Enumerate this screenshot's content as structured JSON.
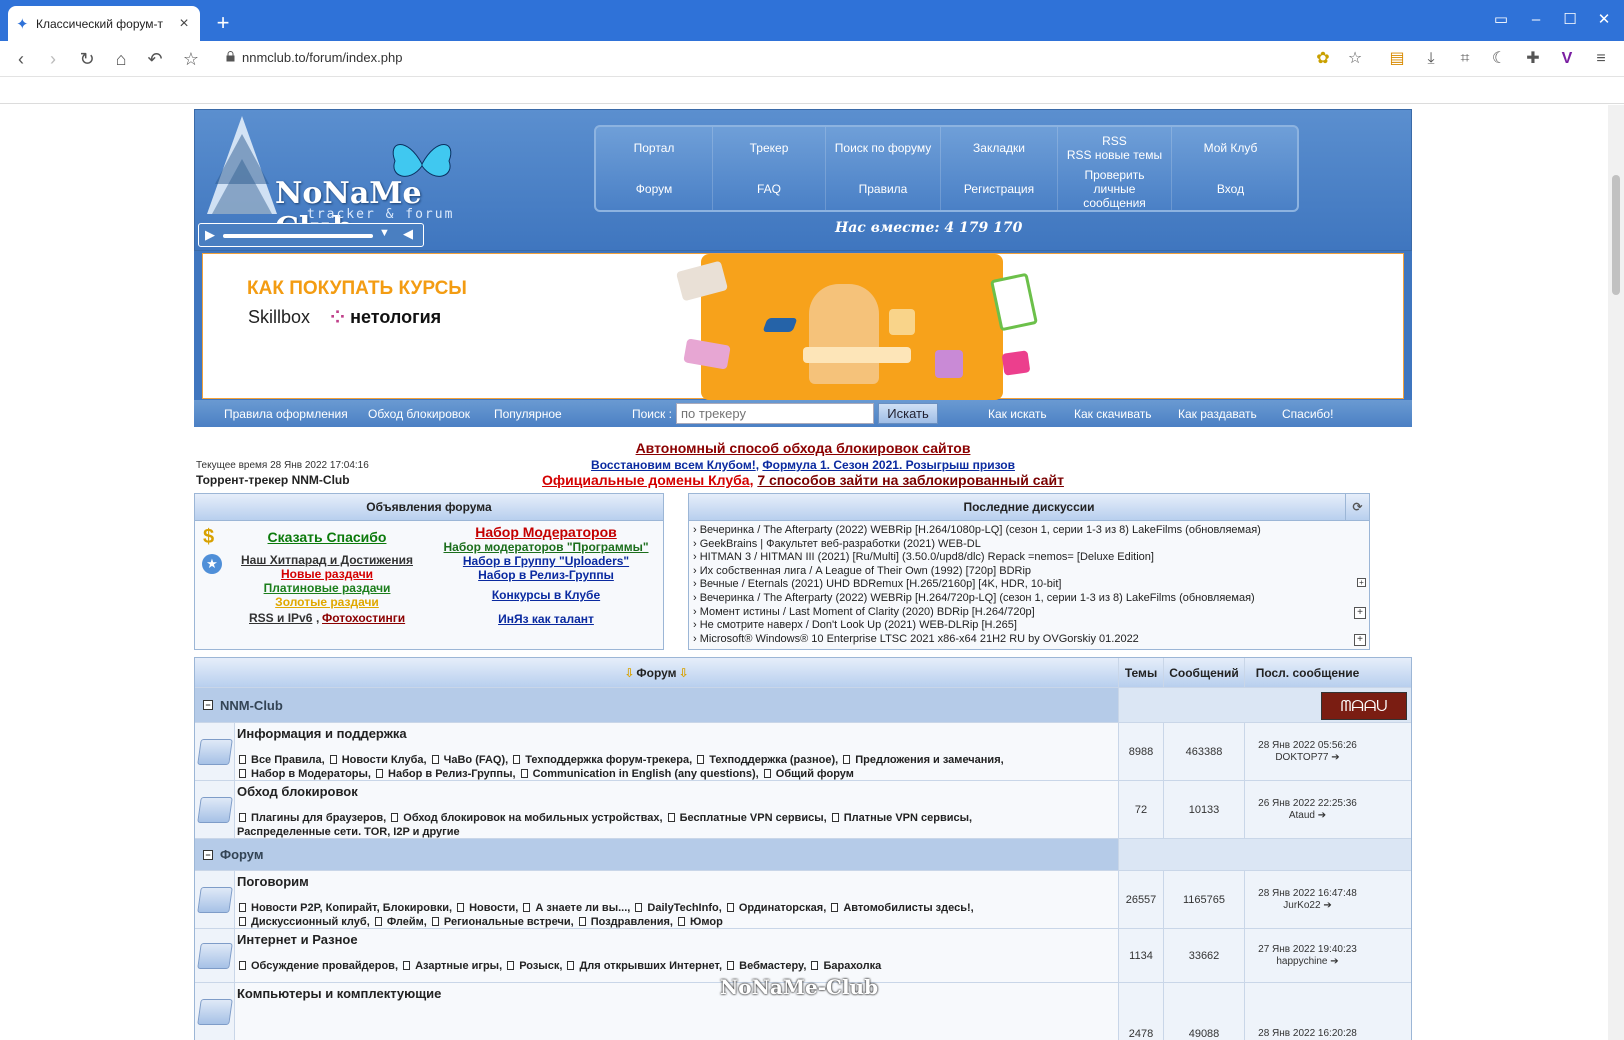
{
  "browser": {
    "tab_title": "Классический форум-т",
    "url": "nnmclub.to/forum/index.php"
  },
  "header": {
    "logo_text": "NoNaMe Club",
    "logo_sub": "tracker & forum",
    "together": "Нас вместе: 4 179 170",
    "nav": [
      "Портал",
      "Трекер",
      "Поиск по форуму",
      "Закладки",
      "RSS\nRSS новые темы",
      "Мой Клуб",
      "Форум",
      "FAQ",
      "Правила",
      "Регистрация",
      "Проверить личные сообщения",
      "Вход"
    ]
  },
  "banner": {
    "title": "КАК ПОКУПАТЬ КУРСЫ",
    "brand1": "Skillbox",
    "brand2": "нетология"
  },
  "navbar": {
    "links_left": [
      "Правила оформления",
      "Обход блокировок",
      "Популярное"
    ],
    "search_label": "Поиск :",
    "search_placeholder": "по трекеру",
    "search_button": "Искать",
    "links_right": [
      "Как искать",
      "Как скачивать",
      "Как раздавать",
      "Спасибо!"
    ]
  },
  "info": {
    "time": "Текущее время 28 Янв 2022 17:04:16",
    "tracker_name": "Торрент-трекер NNM-Club",
    "ann1": "Автономный способ обхода блокировок сайтов",
    "ann2a": "Восстановим всем Клубом!",
    "ann2b": "Формула 1. Сезон 2021. Розыгрыш призов",
    "ann3a": "Официальные домены Клуба",
    "ann3b": "7 способов зайти на заблокированный сайт"
  },
  "ann_panel": {
    "title": "Объявления форума",
    "thanks": "Сказать Спасибо",
    "hits": "Наш Хитпарад и Достижения",
    "new": "Новые раздачи",
    "platinum": "Платиновые раздачи",
    "gold": "Золотые раздачи",
    "rss": "RSS и IPv6",
    "photo": "Фотохостинги",
    "mods": "Набор Модераторов",
    "mods_prog": "Набор модераторов \"Программы\"",
    "uploaders": "Набор в Группу \"Uploaders\"",
    "release": "Набор в Релиз-Группы",
    "contests": "Конкурсы в Клубе",
    "inyaz": "ИнЯз как талант"
  },
  "disc_panel": {
    "title": "Последние дискуссии",
    "items": [
      "› Вечеринка / The Afterparty (2022) WEBRip [H.264/1080p-LQ] (сезон 1, серии 1-3 из 8) LakeFilms (обновляемая)",
      "› GeekBrains | Факультет веб-разработки (2021) WEB-DL",
      "› HITMAN 3 / HITMAN III (2021) [Ru/Multi] (3.50.0/upd8/dlc) Repack =nemos= [Deluxe Edition]",
      "› Их собственная лига / A League of Their Own (1992) [720p] BDRip",
      "› Вечные / Eternals (2021) UHD BDRemux [H.265/2160p] [4K, HDR, 10-bit]",
      "› Вечеринка / The Afterparty (2022) WEBRip [H.264/720p-LQ] (сезон 1, серии 1-3 из 8) LakeFilms (обновляемая)",
      "› Момент истины / Last Moment of Clarity (2020) BDRip [H.264/720p]",
      "› Не смотрите наверх / Don't Look Up (2021) WEB-DLRip [H.265]",
      "› Microsoft® Windows® 10 Enterprise LTSC 2021 x86-x64 21H2 RU by OVGorskiy 01.2022"
    ]
  },
  "forum": {
    "header": {
      "forum": "Форум",
      "topics": "Темы",
      "posts": "Сообщений",
      "last": "Посл. сообщение"
    },
    "categories": [
      {
        "name": "NNM-Club",
        "forums": [
          {
            "title": "Информация и поддержка",
            "subs": [
              "Все Правила",
              "Новости Клуба",
              "ЧаВо (FAQ)",
              "Техподдержка форум-трекера",
              "Техподдержка (разное)",
              "Предложения и замечания",
              "Набор в Модераторы",
              "Набор в Релиз-Группы",
              "Communication in English (any questions)",
              "Общий форум"
            ],
            "topics": "8988",
            "posts": "463388",
            "last_date": "28 Янв 2022 05:56:26",
            "last_user": "DOKTOP77"
          },
          {
            "title": "Обход блокировок",
            "subs": [
              "Плагины для браузеров",
              "Обход блокировок на мобильных устройствах",
              "Бесплатные VPN сервисы",
              "Платные VPN сервисы",
              "Распределенные сети. TOR, I2P и другие"
            ],
            "topics": "72",
            "posts": "10133",
            "last_date": "26 Янв 2022 22:25:36",
            "last_user": "Ataud"
          }
        ]
      },
      {
        "name": "Форум",
        "forums": [
          {
            "title": "Поговорим",
            "subs": [
              "Новости P2P, Копирайт, Блокировки",
              "Новости",
              "А знаете ли вы...",
              "DailyTechInfo",
              "Ординаторская",
              "Автомобилисты здесь!",
              "Дискуссионный клуб",
              "Флейм",
              "Региональные встречи",
              "Поздравления",
              "Юмор"
            ],
            "topics": "26557",
            "posts": "1165765",
            "last_date": "28 Янв 2022 16:47:48",
            "last_user": "JurKo22"
          },
          {
            "title": "Интернет и Разное",
            "subs": [
              "Обсуждение провайдеров",
              "Азартные игры",
              "Розыск",
              "Для открывших Интернет",
              "Вебмастеру",
              "Барахолка"
            ],
            "topics": "1134",
            "posts": "33662",
            "last_date": "27 Янв 2022 19:40:23",
            "last_user": "happychine"
          },
          {
            "title": "Компьютеры и комплектующие",
            "subs": [],
            "topics": "2478",
            "posts": "49088",
            "last_date": "28 Янв 2022 16:20:28",
            "last_user": ""
          }
        ]
      }
    ]
  },
  "watermark": "NoNaMe-Club"
}
